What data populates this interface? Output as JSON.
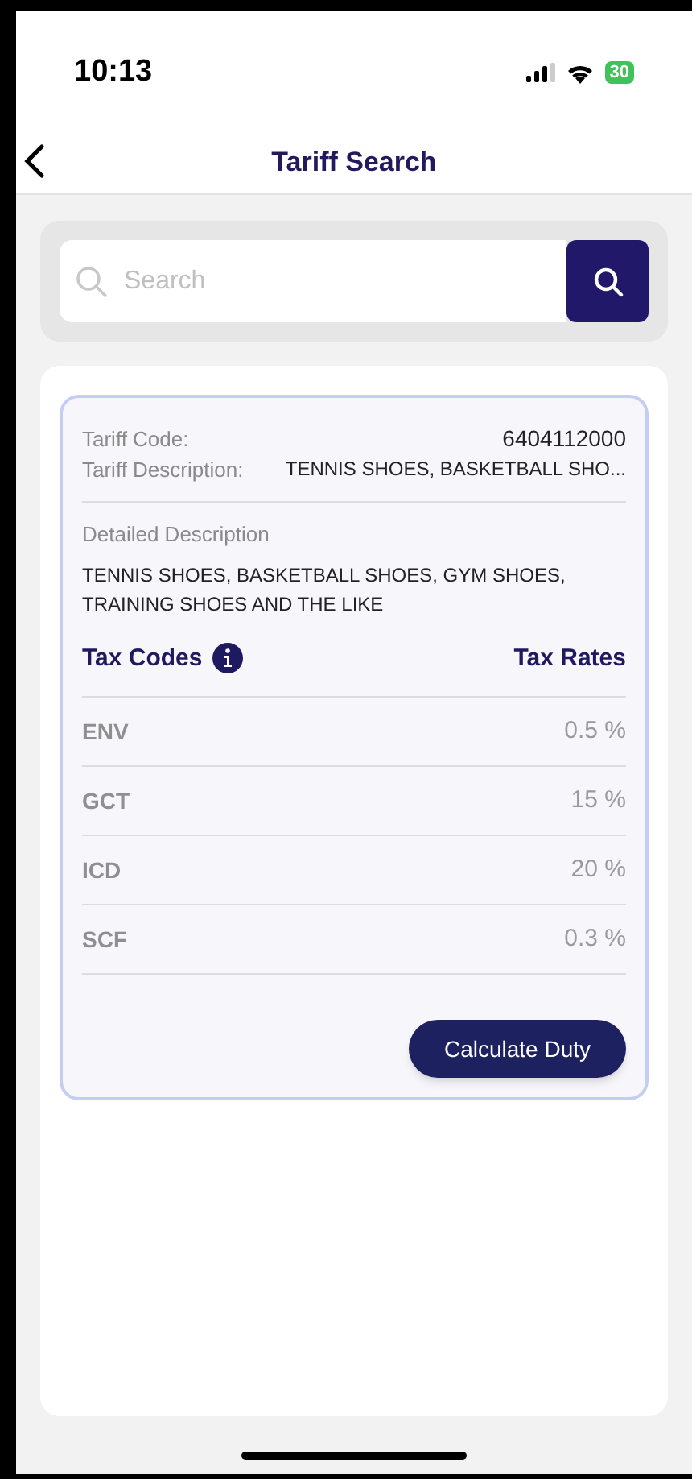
{
  "status_bar": {
    "time": "10:13",
    "battery": "30"
  },
  "header": {
    "title": "Tariff Search"
  },
  "search": {
    "placeholder": "Search"
  },
  "details": {
    "code_label": "Tariff Code:",
    "code": "6404112000",
    "description_label": "Tariff Description:",
    "description": "TENNIS SHOES, BASKETBALL SHO...",
    "detailed_label": "Detailed Description",
    "detailed": "TENNIS SHOES, BASKETBALL SHOES, GYM SHOES, TRAINING SHOES AND THE LIKE"
  },
  "taxes": {
    "codes_heading": "Tax Codes",
    "rates_heading": "Tax Rates",
    "rows": [
      {
        "code": "ENV",
        "rate": "0.5 %"
      },
      {
        "code": "GCT",
        "rate": "15 %"
      },
      {
        "code": "ICD",
        "rate": "20 %"
      },
      {
        "code": "SCF",
        "rate": "0.3 %"
      }
    ]
  },
  "action": {
    "label": "Calculate Duty"
  }
}
